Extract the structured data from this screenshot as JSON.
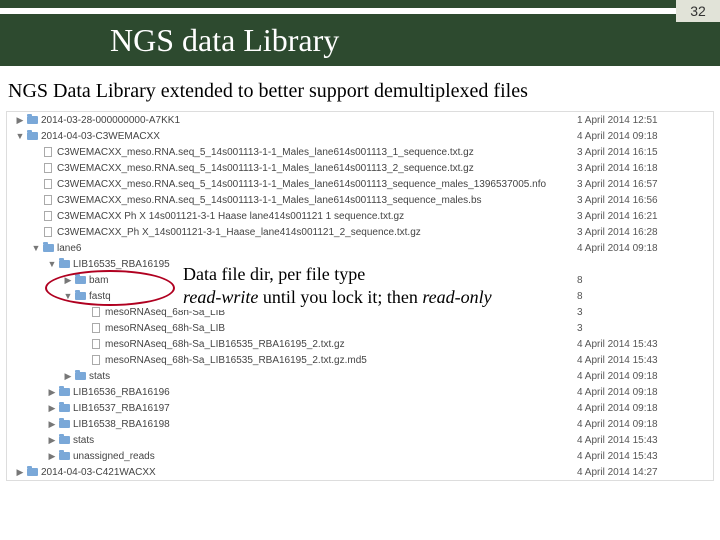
{
  "page_number": "32",
  "title": "NGS data Library",
  "subtitle": "NGS Data Library extended to better support demultiplexed files",
  "annotation": {
    "line1": "Data file dir, per file type",
    "rw": "read-write",
    "mid": " until you lock it; then  ",
    "ro": "read-only"
  },
  "top_rows": [
    {
      "indent": 0,
      "arrow": "▶",
      "type": "folder",
      "name": "2014-03-28-000000000-A7KK1",
      "date": "1 April 2014 12:51"
    },
    {
      "indent": 0,
      "arrow": "▼",
      "type": "folder",
      "name": "2014-04-03-C3WEMACXX",
      "date": "4 April 2014 09:18"
    },
    {
      "indent": 1,
      "arrow": "",
      "type": "file",
      "name": "C3WEMACXX_meso.RNA.seq_5_14s001113-1-1_Males_lane614s001113_1_sequence.txt.gz",
      "date": "3 April 2014 16:15"
    },
    {
      "indent": 1,
      "arrow": "",
      "type": "file",
      "name": "C3WEMACXX_meso.RNA.seq_5_14s001113-1-1_Males_lane614s001113_2_sequence.txt.gz",
      "date": "3 April 2014 16:18"
    },
    {
      "indent": 1,
      "arrow": "",
      "type": "file",
      "name": "C3WEMACXX_meso.RNA.seq_5_14s001113-1-1_Males_lane614s001113_sequence_males_1396537005.nfo",
      "date": "3 April 2014 16:57"
    },
    {
      "indent": 1,
      "arrow": "",
      "type": "file",
      "name": "C3WEMACXX_meso.RNA.seq_5_14s001113-1-1_Males_lane614s001113_sequence_males.bs",
      "date": "3 April 2014 16:56"
    },
    {
      "indent": 1,
      "arrow": "",
      "type": "file",
      "name": "C3WEMACXX Ph X 14s001121-3-1 Haase lane414s001121 1 sequence.txt.gz",
      "date": "3 April 2014 16:21"
    },
    {
      "indent": 1,
      "arrow": "",
      "type": "file",
      "name": "C3WEMACXX_Ph X_14s001121-3-1_Haase_lane414s001121_2_sequence.txt.gz",
      "date": "3 April 2014 16:28"
    },
    {
      "indent": 1,
      "arrow": "▼",
      "type": "folder",
      "name": "lane6",
      "date": "4 April 2014 09:18"
    }
  ],
  "lane_rows": [
    {
      "indent": 2,
      "arrow": "▼",
      "type": "folder",
      "name": "LIB16535_RBA16195",
      "date": ""
    },
    {
      "indent": 3,
      "arrow": "▶",
      "type": "folder",
      "name": "bam",
      "date": "8"
    },
    {
      "indent": 3,
      "arrow": "▼",
      "type": "folder",
      "name": "fastq",
      "date": "8"
    },
    {
      "indent": 4,
      "arrow": "",
      "type": "file",
      "name": "mesoRNAseq_68h-Sa_LIB",
      "date": "3"
    },
    {
      "indent": 4,
      "arrow": "",
      "type": "file",
      "name": "mesoRNAseq_68h-Sa_LIB",
      "date": "3"
    },
    {
      "indent": 4,
      "arrow": "",
      "type": "file",
      "name": "mesoRNAseq_68h-Sa_LIB16535_RBA16195_2.txt.gz",
      "date": "4 April 2014 15:43"
    },
    {
      "indent": 4,
      "arrow": "",
      "type": "file",
      "name": "mesoRNAseq_68h-Sa_LIB16535_RBA16195_2.txt.gz.md5",
      "date": "4 April 2014 15:43"
    },
    {
      "indent": 3,
      "arrow": "▶",
      "type": "folder",
      "name": "stats",
      "date": "4 April 2014 09:18"
    },
    {
      "indent": 2,
      "arrow": "▶",
      "type": "folder",
      "name": "LIB16536_RBA16196",
      "date": "4 April 2014 09:18"
    },
    {
      "indent": 2,
      "arrow": "▶",
      "type": "folder",
      "name": "LIB16537_RBA16197",
      "date": "4 April 2014 09:18"
    },
    {
      "indent": 2,
      "arrow": "▶",
      "type": "folder",
      "name": "LIB16538_RBA16198",
      "date": "4 April 2014 09:18"
    },
    {
      "indent": 2,
      "arrow": "▶",
      "type": "folder",
      "name": "stats",
      "date": "4 April 2014 15:43"
    },
    {
      "indent": 2,
      "arrow": "▶",
      "type": "folder",
      "name": "unassigned_reads",
      "date": "4 April 2014 15:43"
    }
  ],
  "bottom_row": {
    "indent": 0,
    "arrow": "▶",
    "type": "folder",
    "name": "2014-04-03-C421WACXX",
    "date": "4 April 2014 14:27"
  }
}
